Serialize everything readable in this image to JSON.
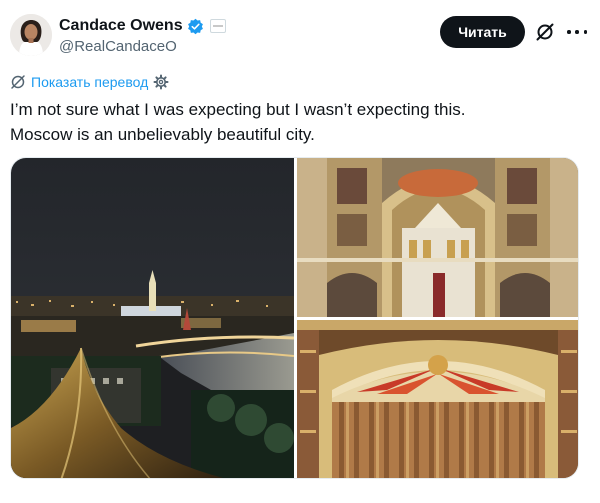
{
  "tweet": {
    "author": {
      "display_name": "Candace Owens",
      "handle": "@RealCandaceO"
    },
    "follow_label": "Читать",
    "translate_label": "Показать перевод",
    "text_lines": [
      "I’m not sure what I was expecting but I wasn’t expecting this.",
      "Moscow is an unbelievably beautiful city."
    ]
  },
  "icons": {
    "verified": "verified-badge-icon",
    "affiliate": "affiliate-badge-icon",
    "grok": "grok-icon",
    "more": "more-icon",
    "translate_left": "translate-icon",
    "translate_right": "settings-gear-icon"
  },
  "colors": {
    "accent": "#1d9bf0",
    "text": "#0f1419",
    "secondary_text": "#536471",
    "button_bg": "#0f1419"
  }
}
